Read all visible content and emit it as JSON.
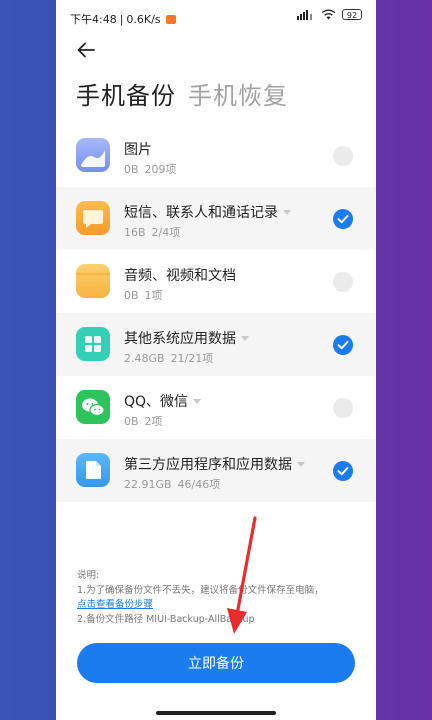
{
  "status_bar": {
    "time": "下午4:48",
    "separator": "|",
    "net_speed": "0.6K/s",
    "battery": "92"
  },
  "header": {
    "tab_backup": "手机备份",
    "tab_restore": "手机恢复"
  },
  "items": [
    {
      "name": "图片",
      "size": "0B",
      "count": "209项",
      "checked": false,
      "icon": "photos-icon",
      "color": "#8fa9f5"
    },
    {
      "name": "短信、联系人和通话记录",
      "size": "16B",
      "count": "2/4项",
      "checked": true,
      "icon": "message-icon",
      "color": "#f7ad3d"
    },
    {
      "name": "音频、视频和文档",
      "size": "0B",
      "count": "1项",
      "checked": false,
      "icon": "folder-icon",
      "color": "#f9c25a"
    },
    {
      "name": "其他系统应用数据",
      "size": "2.48GB",
      "count": "21/21项",
      "checked": true,
      "icon": "grid-icon",
      "color": "#34d0b5"
    },
    {
      "name": "QQ、微信",
      "size": "0B",
      "count": "2项",
      "checked": false,
      "icon": "wechat-icon",
      "color": "#2dc45c"
    },
    {
      "name": "第三方应用程序和应用数据",
      "size": "22.91GB",
      "count": "46/46项",
      "checked": true,
      "icon": "file-icon",
      "color": "#46a8f5"
    }
  ],
  "notes": {
    "title": "说明:",
    "line1": "1.为了确保备份文件不丢失，建议将备份文件保存至电脑，",
    "link": "点击查看备份步骤",
    "line2": "2.备份文件路径 MIUI-Backup-AllBackup"
  },
  "backup_button": "立即备份",
  "colors": {
    "accent": "#1b7cf0",
    "arrow": "#e82c2c"
  }
}
